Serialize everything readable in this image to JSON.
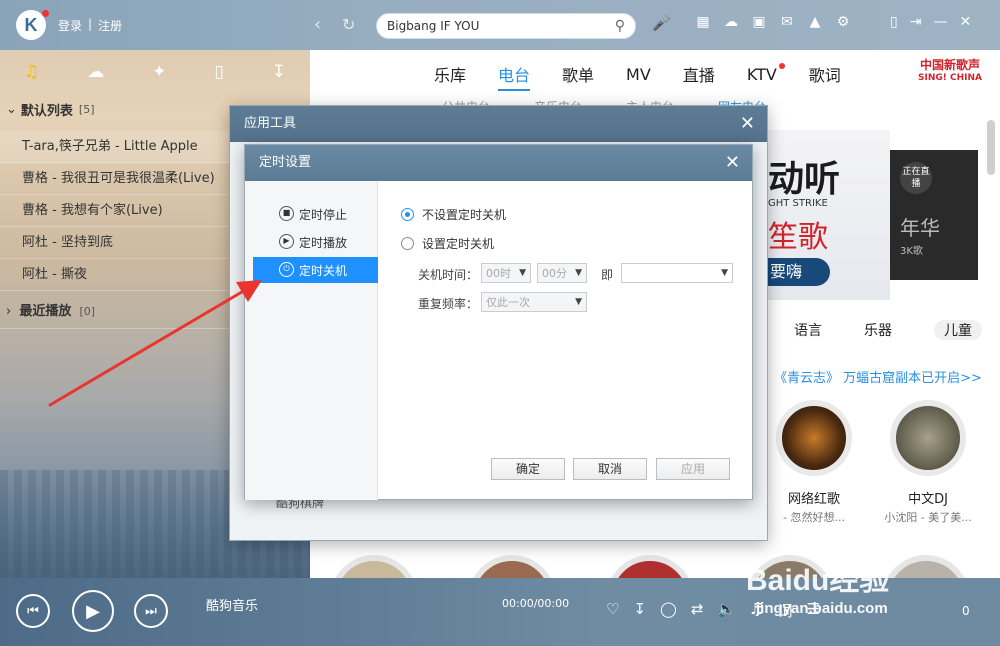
{
  "window": {
    "login": "登录",
    "register": "注册",
    "search_value": "Bigbang IF YOU"
  },
  "top_icons": [
    "grid-icon",
    "cloud-icon",
    "gamepad-icon",
    "mail-icon",
    "skin-icon",
    "gear-icon"
  ],
  "main_tabs": [
    "乐库",
    "电台",
    "歌单",
    "MV",
    "直播",
    "KTV",
    "歌词"
  ],
  "active_tab": "电台",
  "new_song": {
    "title": "中国新歌声",
    "subtitle": "SING! CHINA"
  },
  "sub_tabs": [
    "公共电台",
    "音乐电台",
    "主人电台",
    "网友电台"
  ],
  "sidebar": {
    "playlist_title": "默认列表",
    "playlist_count": "[5]",
    "songs": [
      "T-ara,筷子兄弟 - Little Apple",
      "曹格 - 我很丑可是我很温柔(Live)",
      "曹格 - 我想有个家(Live)",
      "阿杜 - 坚持到底",
      "阿杜 - 撕夜"
    ],
    "recent_title": "最近播放",
    "recent_count": "[0]"
  },
  "banner": {
    "t1": "动听",
    "t2": "GHT STRIKE",
    "t3": "笙歌",
    "t4": "要嗨",
    "live": "正在直播",
    "name": "年华",
    "tag": "3K歌"
  },
  "categories": [
    "语言",
    "乐器",
    "儿童"
  ],
  "notice": "《青云志》 万蝠古窟副本已开启>>",
  "radios": [
    {
      "name": "网络红歌",
      "desc": "- 忽然好想..."
    },
    {
      "name": "中文DJ",
      "desc": "小沈阳 - 美了美..."
    }
  ],
  "app_tool": {
    "title": "应用工具",
    "footer": "酷狗棋牌"
  },
  "timer": {
    "title": "定时设置",
    "nav": [
      "定时停止",
      "定时播放",
      "定时关机"
    ],
    "active_nav": "定时关机",
    "opt_none": "不设置定时关机",
    "opt_set": "设置定时关机",
    "shutdown_time_label": "关机时间：",
    "hour": "00时",
    "minute": "00分",
    "ji": "即",
    "repeat_label": "重复频率：",
    "repeat_value": "仅此一次",
    "ok": "确定",
    "cancel": "取消",
    "apply": "应用"
  },
  "player": {
    "track": "酷狗音乐",
    "time": "00:00/00:00",
    "count": "0"
  },
  "watermark": {
    "logo": "Baidu经验",
    "url": "jingyan.baidu.com"
  },
  "colors": {
    "accent": "#1e90ff",
    "tab_active": "#2b8fe0",
    "arrow": "#e8362f",
    "brand_red": "#d2232a"
  }
}
